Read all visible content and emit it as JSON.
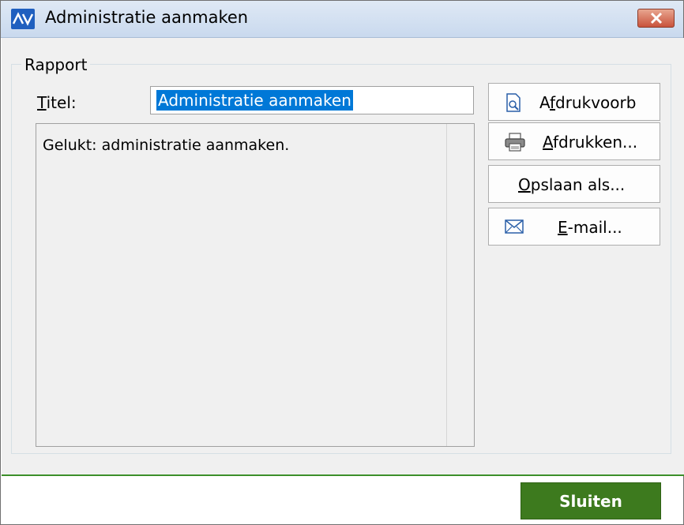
{
  "window": {
    "title": "Administratie aanmaken",
    "icon": "av-logo-icon"
  },
  "group": {
    "legend": "Rapport"
  },
  "title_field": {
    "label_accel": "T",
    "label_rest": "itel:",
    "value": "Administratie aanmaken"
  },
  "report": {
    "text": "Gelukt: administratie aanmaken."
  },
  "buttons": {
    "preview": {
      "pre": "A",
      "accel": "f",
      "post": "drukvoorb",
      "icon": "print-preview-icon"
    },
    "print": {
      "pre": "",
      "accel": "A",
      "post": "fdrukken...",
      "icon": "printer-icon"
    },
    "save": {
      "pre": "",
      "accel": "O",
      "post": "pslaan als..."
    },
    "email": {
      "pre": "",
      "accel": "E",
      "post": "-mail...",
      "icon": "envelope-icon"
    }
  },
  "footer": {
    "close_label": "Sluiten"
  },
  "colors": {
    "accent_green": "#3d7a1e",
    "selection_blue": "#0078d7",
    "close_red": "#c9533c"
  }
}
